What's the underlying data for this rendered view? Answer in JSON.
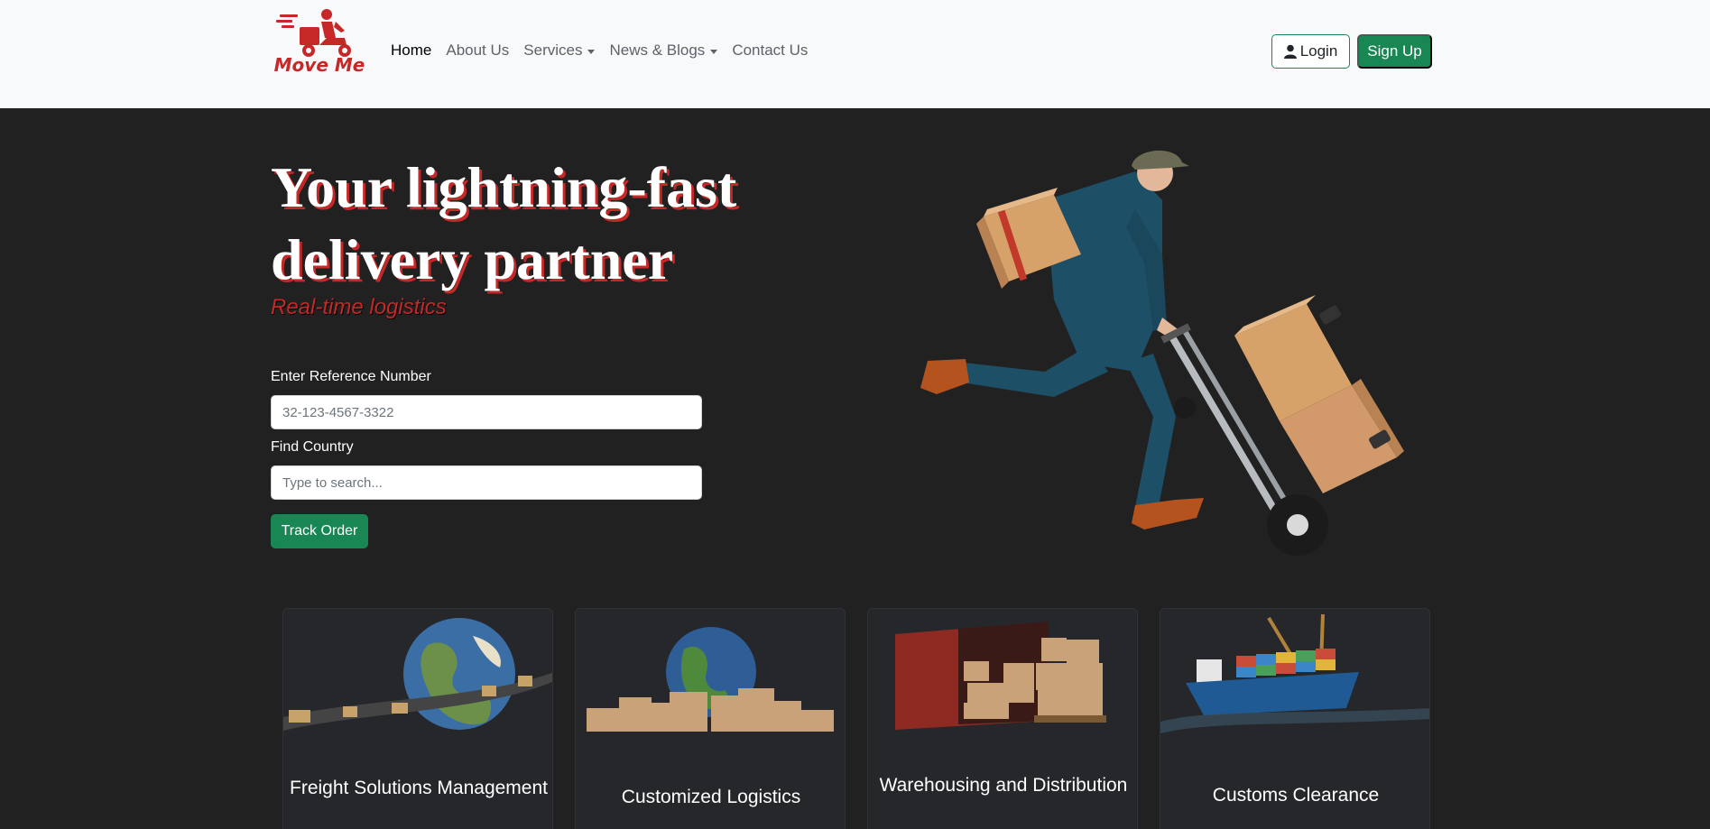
{
  "brand": {
    "name": "Move Me",
    "color": "#c62828"
  },
  "nav": {
    "items": [
      {
        "label": "Home",
        "active": true,
        "dropdown": false
      },
      {
        "label": "About Us",
        "active": false,
        "dropdown": false
      },
      {
        "label": "Services",
        "active": false,
        "dropdown": true
      },
      {
        "label": "News & Blogs",
        "active": false,
        "dropdown": true
      },
      {
        "label": "Contact Us",
        "active": false,
        "dropdown": false
      }
    ],
    "login_label": "Login",
    "signup_label": "Sign Up"
  },
  "hero": {
    "title": "Your lightning-fast delivery partner",
    "subtitle": "Real-time logistics",
    "reference_label": "Enter Reference Number",
    "reference_placeholder": "32-123-4567-3322",
    "country_label": "Find Country",
    "country_placeholder": "Type to search...",
    "track_label": "Track Order"
  },
  "services": [
    {
      "title": "Freight Solutions Management",
      "icon": "globe-conveyor-icon"
    },
    {
      "title": "Customized Logistics",
      "icon": "globe-boxes-icon"
    },
    {
      "title": "Warehousing and Distribution",
      "icon": "container-icon"
    },
    {
      "title": "Customs Clearance",
      "icon": "cargo-ship-icon"
    }
  ],
  "colors": {
    "accent": "#198754",
    "brand": "#c62828",
    "background": "#212121",
    "navbar": "#f8f9fa"
  }
}
